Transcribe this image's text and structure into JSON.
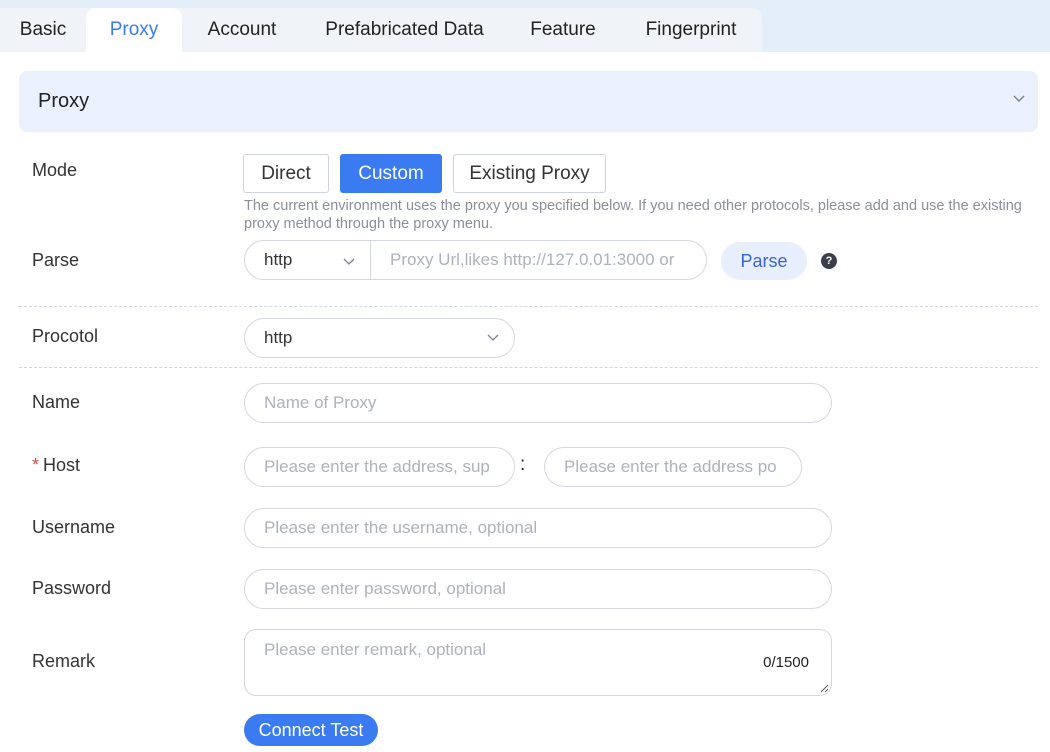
{
  "tabs": {
    "basic": "Basic",
    "proxy": "Proxy",
    "account": "Account",
    "prefab": "Prefabricated Data",
    "feature": "Feature",
    "fingerprint": "Fingerprint"
  },
  "section": {
    "title": "Proxy"
  },
  "mode": {
    "label": "Mode",
    "options": {
      "direct": "Direct",
      "custom": "Custom",
      "existing": "Existing Proxy"
    },
    "selected": "Custom",
    "hint": "The current environment uses the proxy you specified below. If you need other protocols, please add and use the existing proxy method through the proxy menu."
  },
  "parse": {
    "label": "Parse",
    "protocol": "http",
    "placeholder": "Proxy Url,likes http://127.0.01:3000 or",
    "button": "Parse",
    "help": "?"
  },
  "protocol": {
    "label": "Procotol",
    "value": "http"
  },
  "name": {
    "label": "Name",
    "placeholder": "Name of Proxy"
  },
  "host": {
    "required_mark": "*",
    "label": "Host",
    "placeholder": "Please enter the address, sup",
    "separator": ":",
    "port_placeholder": "Please enter the address po"
  },
  "username": {
    "label": "Username",
    "placeholder": "Please enter the username, optional"
  },
  "password": {
    "label": "Password",
    "placeholder": "Please enter password, optional"
  },
  "remark": {
    "label": "Remark",
    "placeholder": "Please enter remark, optional",
    "counter": "0/1500"
  },
  "actions": {
    "test": "Connect Test"
  },
  "colors": {
    "accent": "#3a7bf2",
    "required": "#e2493d",
    "card_bg": "#eaf1fd"
  }
}
